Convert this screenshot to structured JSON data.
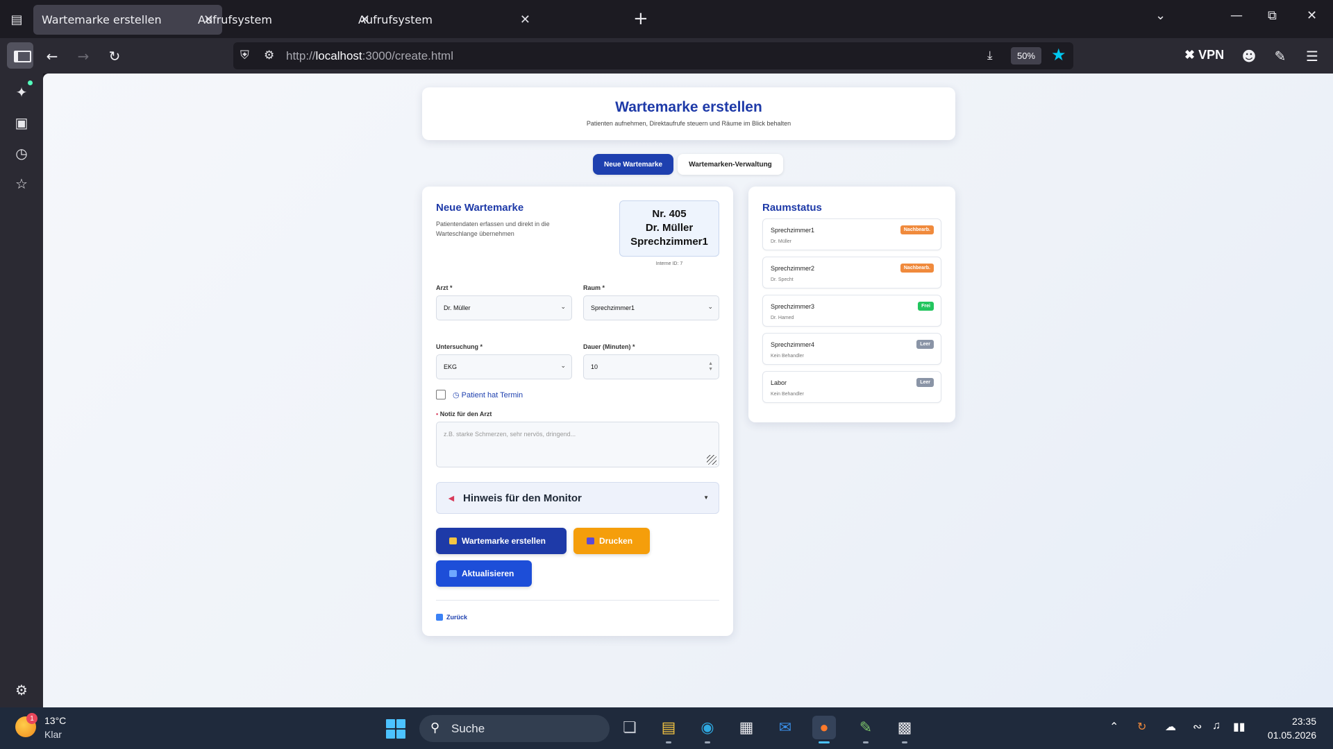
{
  "browser": {
    "tabs": [
      {
        "title": "Wartemarke erstellen",
        "active": true
      },
      {
        "title": "Aufrufsystem",
        "active": false
      },
      {
        "title": "Aufrufsystem",
        "active": false
      }
    ],
    "url_prefix": "http://",
    "url_host": "localhost",
    "url_path": ":3000/create.html",
    "zoom": "50%",
    "vpn_label": "VPN"
  },
  "page": {
    "title": "Wartemarke erstellen",
    "subtitle": "Patienten aufnehmen, Direktaufrufe steuern und Räume im Blick behalten",
    "tabs": [
      {
        "label": "Neue Wartemarke",
        "active": true
      },
      {
        "label": "Wartemarken-Verwaltung",
        "active": false
      }
    ]
  },
  "form": {
    "title": "Neue Wartemarke",
    "description": "Patientendaten erfassen und direkt in die Warteschlange übernehmen",
    "ticket": {
      "number": "Nr. 405",
      "doctor": "Dr. Müller",
      "room": "Sprechzimmer1"
    },
    "internal_id": "Interne ID: 7",
    "doctor_label": "Arzt *",
    "doctor_value": "Dr. Müller",
    "room_label": "Raum *",
    "room_value": "Sprechzimmer1",
    "exam_label": "Untersuchung *",
    "exam_value": "EKG",
    "duration_label": "Dauer (Minuten) *",
    "duration_value": "10",
    "appointment_label": "Patient hat Termin",
    "appointment_checked": false,
    "note_label": "Notiz für den Arzt",
    "note_placeholder": "z.B. starke Schmerzen, sehr nervös, dringend...",
    "monitor_hint_label": "Hinweis für den Monitor",
    "create_button": "Wartemarke erstellen",
    "print_button": "Drucken",
    "refresh_button": "Aktualisieren",
    "back_link": "Zurück"
  },
  "rooms": {
    "title": "Raumstatus",
    "items": [
      {
        "name": "Sprechzimmer1",
        "doctor": "Dr. Müller",
        "status": "Nachbearb.",
        "color": "#f08a3c"
      },
      {
        "name": "Sprechzimmer2",
        "doctor": "Dr. Specht",
        "status": "Nachbearb.",
        "color": "#f08a3c"
      },
      {
        "name": "Sprechzimmer3",
        "doctor": "Dr. Hamed",
        "status": "Frei",
        "color": "#22c55e"
      },
      {
        "name": "Sprechzimmer4",
        "doctor": "Kein Behandler",
        "status": "Leer",
        "color": "#8a94a6"
      },
      {
        "name": "Labor",
        "doctor": "Kein Behandler",
        "status": "Leer",
        "color": "#8a94a6"
      }
    ]
  },
  "taskbar": {
    "weather_temp": "13°C",
    "weather_desc": "Klar",
    "weather_badge": "1",
    "search_label": "Suche",
    "time": "23:35",
    "date": "01.05.2026"
  },
  "colors": {
    "accent": "#1e3aa8",
    "primary_button": "#1e3aa8",
    "print_button": "#f59e0b",
    "refresh_button": "#1d4ed8"
  }
}
